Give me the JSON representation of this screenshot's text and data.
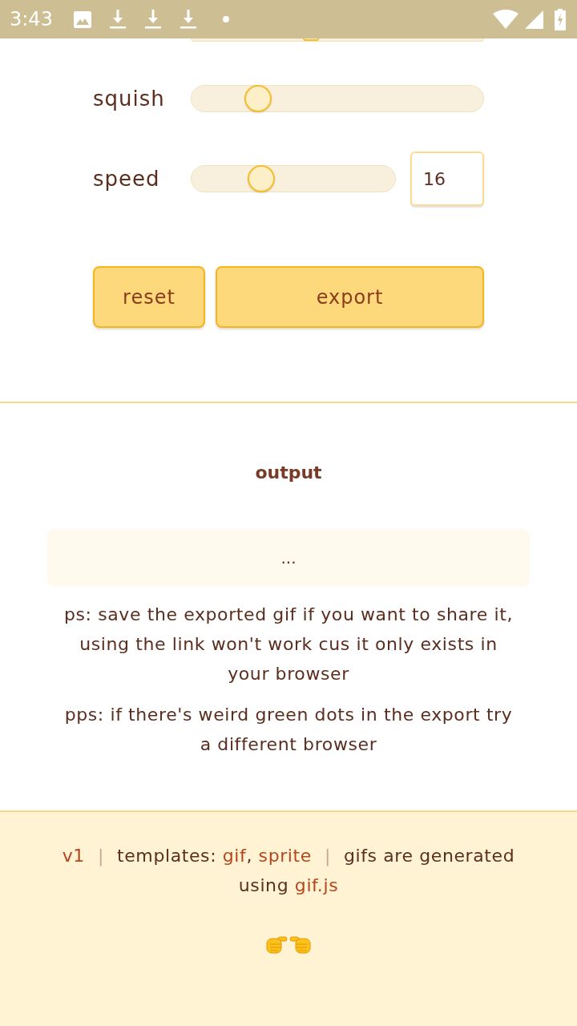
{
  "status_bar": {
    "time": "3:43"
  },
  "clipped_slider": {
    "level": 0.4
  },
  "sliders": [
    {
      "label": "squish",
      "level": 0.2
    },
    {
      "label": "speed",
      "level": 0.32,
      "value": "16"
    }
  ],
  "buttons": [
    {
      "label": "reset"
    },
    {
      "label": "export"
    }
  ],
  "output": {
    "title": "output",
    "content": "...",
    "notes": [
      "ps: save the exported gif if you want to share it, using the link won't work cus it only exists in your browser",
      "pps: if there's weird green dots in the export try a different browser"
    ]
  },
  "footer": {
    "segments": [
      {
        "kind": "link",
        "text": "v1"
      },
      {
        "kind": "separator",
        "text": "|"
      },
      {
        "kind": "text",
        "text": "templates:"
      },
      {
        "kind": "link",
        "text": "gif",
        "suffix": ","
      },
      {
        "kind": "link",
        "text": "sprite"
      },
      {
        "kind": "separator",
        "text": "|"
      },
      {
        "kind": "text",
        "text": "gifs are generated using"
      },
      {
        "kind": "link",
        "text": "gif.js"
      }
    ]
  }
}
